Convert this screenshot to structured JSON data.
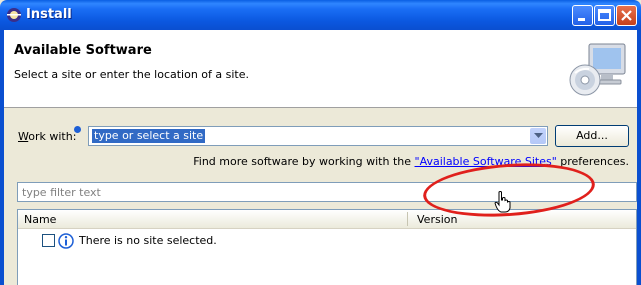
{
  "window": {
    "title": "Install"
  },
  "header": {
    "title": "Available Software",
    "description": "Select a site or enter the location of a site."
  },
  "work_with": {
    "label_prefix": "W",
    "label_rest": "ork with:",
    "value": "type or select a site",
    "add_button": "Add..."
  },
  "find_more": {
    "prefix": "Find more software by working with the ",
    "link": "\"Available Software Sites\"",
    "suffix": " preferences."
  },
  "filter": {
    "placeholder": "type filter text"
  },
  "table": {
    "columns": [
      "Name",
      "Version"
    ],
    "rows": [
      {
        "text": "There is no site selected."
      }
    ]
  },
  "colors": {
    "title_bar": "#0b58e0",
    "selection": "#316ac5",
    "link": "#0000ff",
    "annotation": "#e0201c"
  }
}
